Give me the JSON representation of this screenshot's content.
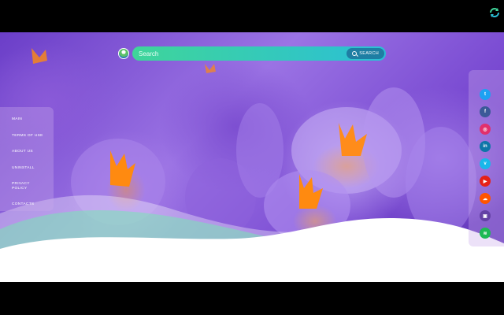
{
  "search": {
    "placeholder": "Search",
    "button_label": "SEARCH"
  },
  "nav": {
    "items": [
      {
        "label": "MAIN"
      },
      {
        "label": "TERMS OF USE"
      },
      {
        "label": "ABOUT US"
      },
      {
        "label": "UNINSTALL"
      },
      {
        "label": "PRIVACY POLICY"
      },
      {
        "label": "CONTACTS"
      }
    ]
  },
  "social": [
    {
      "name": "twitter-icon",
      "glyph": "t",
      "color": "#1da1f2"
    },
    {
      "name": "facebook-icon",
      "glyph": "f",
      "color": "#3b5998"
    },
    {
      "name": "instagram-icon",
      "glyph": "◎",
      "color": "#e1306c"
    },
    {
      "name": "linkedin-icon",
      "glyph": "in",
      "color": "#0e76a8"
    },
    {
      "name": "vimeo-icon",
      "glyph": "v",
      "color": "#1ab7ea"
    },
    {
      "name": "youtube-icon",
      "glyph": "▶",
      "color": "#e62117"
    },
    {
      "name": "soundcloud-icon",
      "glyph": "☁",
      "color": "#ff5500"
    },
    {
      "name": "twitch-icon",
      "glyph": "▣",
      "color": "#6441a5"
    },
    {
      "name": "spotify-icon",
      "glyph": "≋",
      "color": "#1db954"
    }
  ],
  "colors": {
    "accent": "#3fd59a",
    "accent2": "#2bbfd6",
    "button": "#1e7ea3"
  }
}
